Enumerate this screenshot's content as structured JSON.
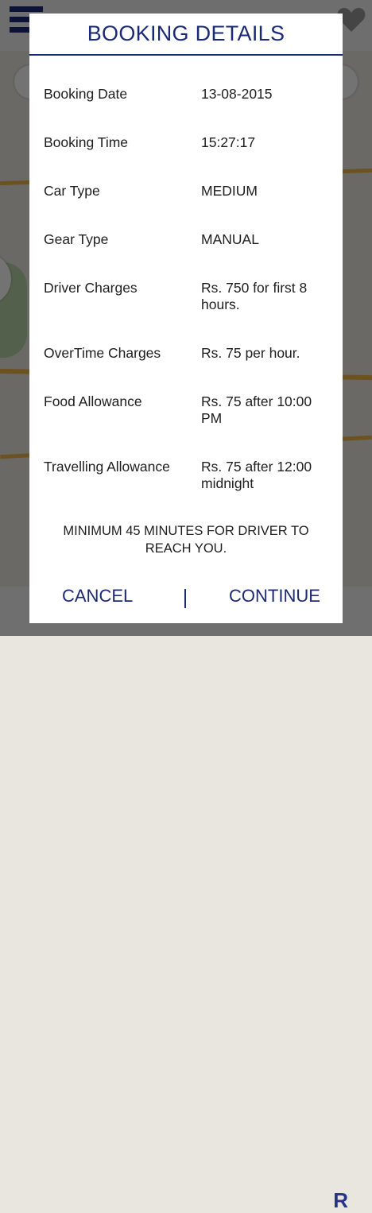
{
  "colors": {
    "accent": "#1b2a78",
    "modal_bg": "#ffffff",
    "text": "#1e1e1e",
    "scrim": "rgba(0,0,0,0.55)"
  },
  "background": {
    "bottom_letter": "R"
  },
  "modal": {
    "title": "BOOKING DETAILS",
    "rows": [
      {
        "label": "Booking Date",
        "value": "13-08-2015"
      },
      {
        "label": "Booking Time",
        "value": "15:27:17"
      },
      {
        "label": "Car Type",
        "value": "MEDIUM"
      },
      {
        "label": "Gear Type",
        "value": "MANUAL"
      },
      {
        "label": "Driver Charges",
        "value": "Rs. 750 for first 8 hours."
      },
      {
        "label": "OverTime Charges",
        "value": "Rs. 75 per hour."
      },
      {
        "label": "Food Allowance",
        "value": "Rs. 75 after 10:00 PM"
      },
      {
        "label": "Travelling Allowance",
        "value": "Rs. 75 after 12:00 midnight"
      }
    ],
    "notice": "MINIMUM 45 MINUTES FOR DRIVER TO REACH YOU.",
    "cancel_label": "CANCEL",
    "separator": "|",
    "continue_label": "CONTINUE"
  }
}
